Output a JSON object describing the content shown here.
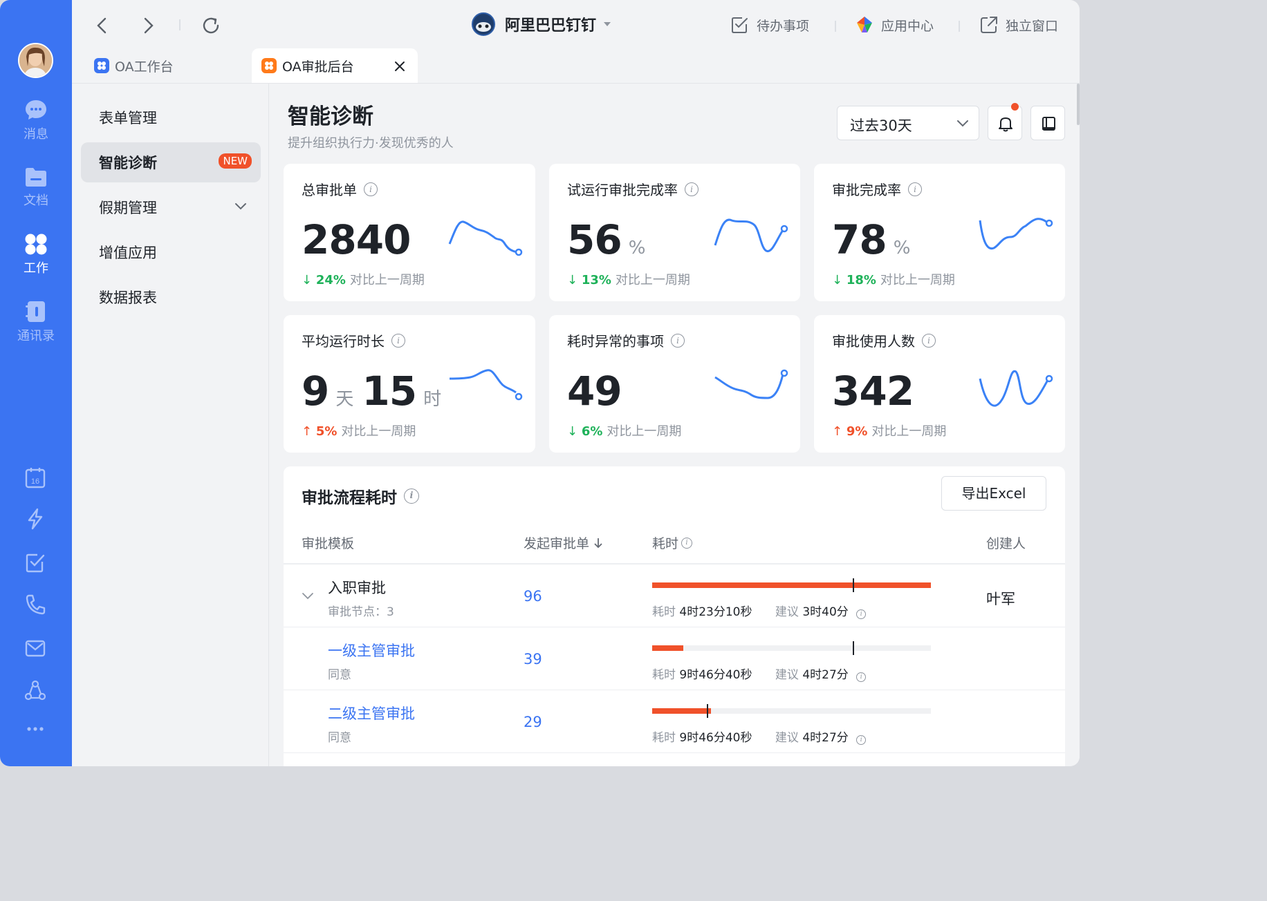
{
  "rail": {
    "items": [
      {
        "label": "消息",
        "icon": "message-icon"
      },
      {
        "label": "文档",
        "icon": "folder-icon"
      },
      {
        "label": "工作",
        "icon": "apps-icon",
        "active": true
      },
      {
        "label": "通讯录",
        "icon": "contacts-icon"
      }
    ],
    "bottom_icons": [
      "calendar-icon",
      "lightning-icon",
      "todo-icon",
      "phone-icon",
      "mail-icon",
      "network-icon",
      "more-icon"
    ],
    "calendar_day": "16"
  },
  "topbar": {
    "org_name": "阿里巴巴钉钉",
    "todo_label": "待办事项",
    "app_center_label": "应用中心",
    "standalone_label": "独立窗口"
  },
  "tabs": [
    {
      "label": "OA工作台",
      "color": "#3b74f2"
    },
    {
      "label": "OA审批后台",
      "color": "#ff7a1a",
      "active": true
    }
  ],
  "subnav": {
    "items": [
      {
        "label": "表单管理"
      },
      {
        "label": "智能诊断",
        "badge": "NEW",
        "active": true
      },
      {
        "label": "假期管理",
        "expandable": true
      },
      {
        "label": "增值应用"
      },
      {
        "label": "数据报表"
      }
    ]
  },
  "header": {
    "title": "智能诊断",
    "subtitle": "提升组织执行力·发现优秀的人",
    "period": "过去30天"
  },
  "kpis": [
    {
      "title": "总审批单",
      "value": "2840",
      "unit": "",
      "direction": "down",
      "delta": "24%",
      "compare": "对比上一周期"
    },
    {
      "title": "试运行审批完成率",
      "value": "56",
      "unit": "%",
      "direction": "down",
      "delta": "13%",
      "compare": "对比上一周期"
    },
    {
      "title": "审批完成率",
      "value": "78",
      "unit": "%",
      "direction": "down",
      "delta": "18%",
      "compare": "对比上一周期"
    },
    {
      "title": "平均运行时长",
      "value": "9",
      "unit": "天",
      "value2": "15",
      "unit2": "时",
      "direction": "up",
      "delta": "5%",
      "compare": "对比上一周期"
    },
    {
      "title": "耗时异常的事项",
      "value": "49",
      "unit": "",
      "direction": "down",
      "delta": "6%",
      "compare": "对比上一周期"
    },
    {
      "title": "审批使用人数",
      "value": "342",
      "unit": "",
      "direction": "up",
      "delta": "9%",
      "compare": "对比上一周期"
    }
  ],
  "flow": {
    "title": "审批流程耗时",
    "export_label": "导出Excel",
    "columns": {
      "template": "审批模板",
      "count": "发起审批单",
      "duration": "耗时",
      "creator": "创建人"
    },
    "rows": [
      {
        "name": "入职审批",
        "sub": "审批节点：3",
        "count": "96",
        "bar_fill": 1.0,
        "suggest_mark": 0.72,
        "duration_label": "耗时",
        "duration": "4时23分10秒",
        "suggest_label": "建议",
        "suggest": "3时40分",
        "creator": "叶军",
        "expandable": true
      },
      {
        "name": "一级主管审批",
        "sub": "同意",
        "count": "39",
        "bar_fill": 0.11,
        "suggest_mark": 0.72,
        "duration_label": "耗时",
        "duration": "9时46分40秒",
        "suggest_label": "建议",
        "suggest": "4时27分",
        "creator": "",
        "link": true
      },
      {
        "name": "二级主管审批",
        "sub": "同意",
        "count": "29",
        "bar_fill": 0.21,
        "suggest_mark": 0.2,
        "duration_label": "耗时",
        "duration": "9时46分40秒",
        "suggest_label": "建议",
        "suggest": "4时27分",
        "creator": "",
        "link": true
      }
    ]
  },
  "colors": {
    "accent": "#3b74f2",
    "positive": "#1fb25a",
    "negative": "#f0512a",
    "spark": "#3b82f6"
  }
}
